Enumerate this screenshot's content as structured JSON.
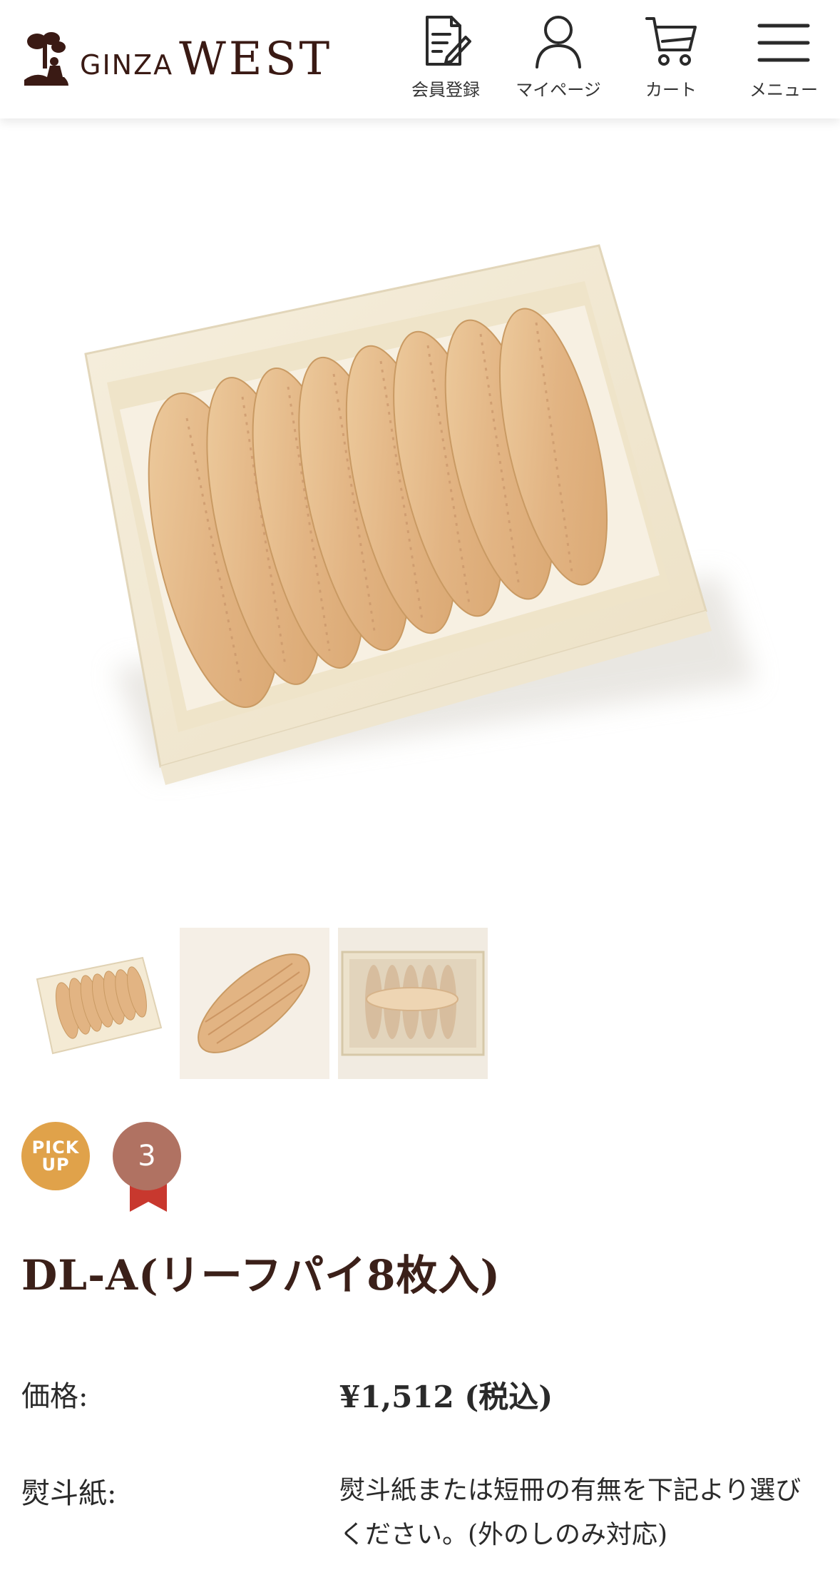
{
  "header": {
    "logo": {
      "prefix": "GINZA",
      "name": "WEST"
    },
    "nav": [
      {
        "label": "会員登録",
        "icon": "register-document-icon"
      },
      {
        "label": "マイページ",
        "icon": "user-icon"
      },
      {
        "label": "カート",
        "icon": "cart-icon"
      },
      {
        "label": "メニュー",
        "icon": "hamburger-menu-icon"
      }
    ]
  },
  "gallery": {
    "main_image": "leaf-pie-box-photo",
    "thumbnails": [
      "leaf-pie-box-thumbnail",
      "single-leaf-pie-thumbnail",
      "wrapped-box-thumbnail"
    ]
  },
  "badges": {
    "pick_up_line1": "PICK",
    "pick_up_line2": "UP",
    "rank": "3"
  },
  "product": {
    "title": "DL-A(リーフパイ8枚入)",
    "price_label": "価格:",
    "price_value": "¥1,512 (税込)",
    "noshi_label": "熨斗紙:",
    "noshi_description": "熨斗紙または短冊の有無を下記より選びください。(外のしのみ対応)"
  },
  "colors": {
    "brand": "#3b2019",
    "pickup_badge": "#e0a24a",
    "rank_badge": "#b07262",
    "ribbon": "#c8382e"
  }
}
